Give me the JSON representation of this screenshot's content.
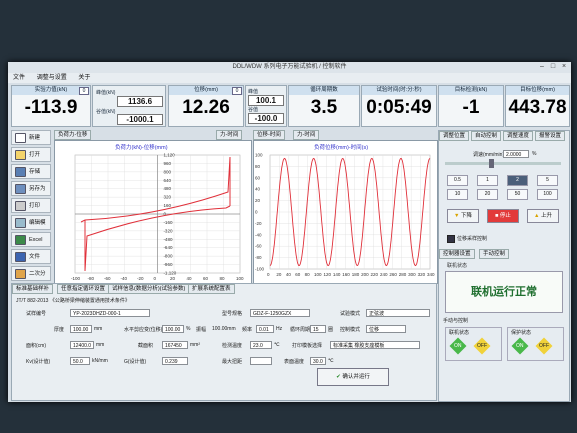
{
  "window": {
    "title": "DDL/WDW 系列电子万能试验机 / 控制软件"
  },
  "menu": [
    "文件",
    "调整与设置",
    "关于"
  ],
  "readouts": [
    {
      "label": "实验力值(kN)",
      "value": "-113.9"
    },
    {
      "label": "位移(mm)",
      "value": "12.26"
    },
    {
      "label": "循环周期数",
      "value": "3.5"
    },
    {
      "label": "试验时间(时:分:秒)",
      "value": "0:05:49"
    },
    {
      "label": "目标检测(kN)",
      "value": "-1"
    },
    {
      "label": "目标位移(mm)",
      "value": "443.78"
    }
  ],
  "peaks": {
    "force": {
      "max_label": "峰值(kN)",
      "max": "1136.6",
      "min_label": "谷值(kN)",
      "min": "-1000.1"
    },
    "cycle": {
      "max_label": "峰值",
      "max": "100.1",
      "min_label": "谷值",
      "min": "-100.0"
    }
  },
  "tools": [
    "新建",
    "打开",
    "存储",
    "另存为",
    "打印",
    "编辑模板",
    "Excel",
    "文件",
    "二次分析"
  ],
  "left_chart": {
    "tabs": [
      "负荷力-位移",
      "力-时间"
    ],
    "title": "负荷力(kN)-位移(mm)",
    "yticks": [
      "1,120",
      "960",
      "800",
      "640",
      "480",
      "320",
      "160",
      "0",
      "-160",
      "-320",
      "-480",
      "-640",
      "-800",
      "-960",
      "-1,120"
    ],
    "xticks": [
      "-100",
      "-80",
      "-60",
      "-40",
      "-20",
      "0",
      "20",
      "40",
      "60",
      "80",
      "100"
    ]
  },
  "right_chart": {
    "tabs": [
      "位移-时间",
      "力-时间"
    ],
    "title": "负荷位移(mm)-时间(s)",
    "yticks": [
      "100",
      "80",
      "60",
      "40",
      "20",
      "0",
      "-20",
      "-40",
      "-60",
      "-80",
      "-100"
    ],
    "xticks": [
      "0",
      "20",
      "40",
      "60",
      "80",
      "100",
      "120",
      "140",
      "160",
      "180",
      "200",
      "220",
      "240",
      "260",
      "280",
      "300",
      "320",
      "340"
    ]
  },
  "control": {
    "tabs": [
      "调整位置",
      "自动控制",
      "调整速度",
      "报警设置"
    ],
    "speed_label": "调速(mm/min)",
    "speed_value": "2.0000",
    "speed_unit": "%",
    "speed_buttons": [
      "0.5",
      "1",
      "2",
      "5",
      "10",
      "20",
      "50",
      "100"
    ],
    "down": "下降",
    "stop": "停止",
    "up": "上升",
    "check": "位移采样控制",
    "tabs2": [
      "控制器设置",
      "手动控制"
    ],
    "status_hdr": "联机状态",
    "status_text": "联机运行正常",
    "manual_hdr": "手动与控制",
    "on_label": "ON",
    "off_label": "OFF",
    "grp1": "联机状态",
    "grp2": "保护状态"
  },
  "form": {
    "tabs": [
      "标准基础样补",
      "任意指定循环设置",
      "试样信息(数据分析)(试验参数)",
      "扩展系统配置表"
    ],
    "standard": "JT/T 882-2013 《公路桥梁伸缩装置通用技术条件》",
    "specimen_no_label": "试样编号",
    "specimen_no": "YP-2023DHZD-000-1",
    "model_label": "型号规格",
    "model": "GDZ-F-1250GZX",
    "mode_label": "试验模式",
    "mode": "正弦波",
    "a_label": "厚度",
    "a": "100.00",
    "a_unit": "mm",
    "b_label": "水平剪应变(位移)",
    "b": "100.00",
    "b_unit": "%",
    "c_label": "振幅",
    "c": "100.00mm",
    "d_label": "频率",
    "d": "0.01",
    "d_unit": "Hz",
    "e_label": "循环周期",
    "e": "15",
    "e_unit": "圈",
    "f_label": "控制模式",
    "f": "位移",
    "g_label": "面积(cm)",
    "g": "12400.0",
    "g_unit": "mm",
    "h_label": "截面积",
    "h": "167450",
    "h_unit": "mm²",
    "i_label": "检测温度",
    "i": "23.0",
    "i_unit": "℃",
    "j_label": "打印模板选择",
    "j": "标准采集 橡胶支座模板",
    "k_label": "Kv(设计值)",
    "k": "50.0",
    "k_unit": "kN/mm",
    "l_label": "G(设计值)",
    "l": "0.239",
    "m_label": "最大扭距",
    "n_label": "表面温度",
    "n": "30.0",
    "n_unit": "℃",
    "start": "确认并运行"
  }
}
